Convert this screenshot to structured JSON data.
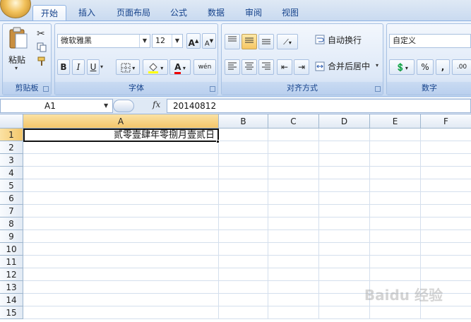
{
  "tabs": [
    {
      "label": "开始",
      "active": true
    },
    {
      "label": "插入"
    },
    {
      "label": "页面布局"
    },
    {
      "label": "公式"
    },
    {
      "label": "数据"
    },
    {
      "label": "审阅"
    },
    {
      "label": "视图"
    }
  ],
  "ribbon": {
    "clipboard": {
      "paste_label": "粘贴",
      "group_label": "剪贴板"
    },
    "font": {
      "font_name": "微软雅黑",
      "font_size": "12",
      "group_label": "字体",
      "bold": "B",
      "italic": "I",
      "underline": "U",
      "grow": "A",
      "shrink": "A",
      "font_color_glyph": "A",
      "phonetic_glyph": "wén"
    },
    "alignment": {
      "wrap_text": "自动换行",
      "merge_center": "合并后居中",
      "group_label": "对齐方式"
    },
    "number": {
      "format": "自定义",
      "percent": "%",
      "comma": ",",
      "group_label": "数字"
    }
  },
  "formula_bar": {
    "name_box": "A1",
    "fx": "fx",
    "value": "20140812"
  },
  "columns": [
    "A",
    "B",
    "C",
    "D",
    "E",
    "F"
  ],
  "rows": [
    "1",
    "2",
    "3",
    "4",
    "5",
    "6",
    "7",
    "8",
    "9",
    "10",
    "11",
    "12",
    "13",
    "14",
    "15"
  ],
  "cells": {
    "A1": "贰零壹肆年零捌月壹贰日"
  },
  "watermark": "Baidu 经验",
  "colors": {
    "accent": "#15428b",
    "selected_header": "#f3c66a"
  }
}
